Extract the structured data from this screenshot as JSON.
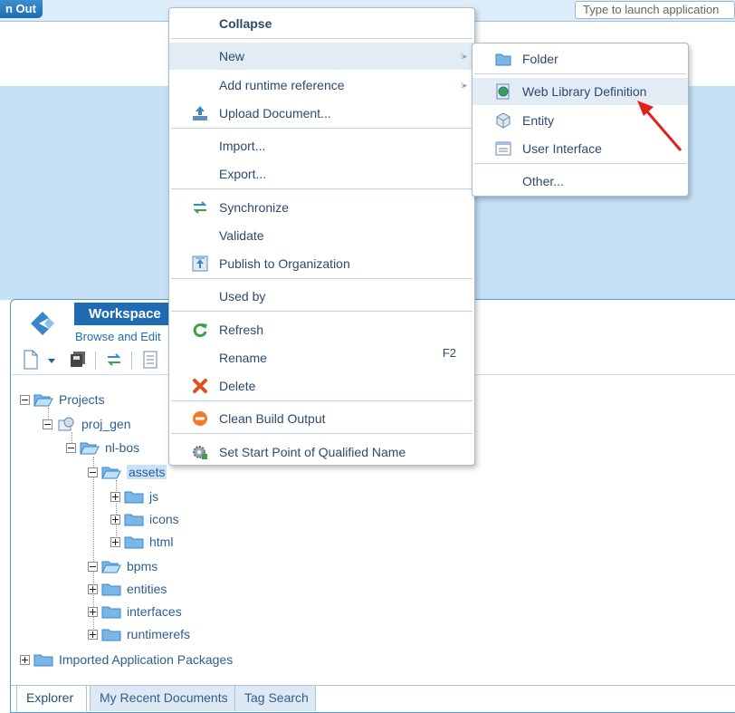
{
  "topbar": {
    "signout_label": "n Out",
    "launch_placeholder": "Type to launch application"
  },
  "workspace": {
    "title": "Workspace",
    "subtitle": "Browse and Edit"
  },
  "tree": {
    "projects": "Projects",
    "proj_gen": "proj_gen",
    "nl_bos": "nl-bos",
    "assets": "assets",
    "js": "js",
    "icons": "icons",
    "html": "html",
    "bpms": "bpms",
    "entities": "entities",
    "interfaces": "interfaces",
    "runtimerefs": "runtimerefs",
    "imported": "Imported Application Packages"
  },
  "tabs": {
    "explorer": "Explorer",
    "recent": "My Recent Documents",
    "tag_search": "Tag Search"
  },
  "context_menu": {
    "collapse": "Collapse",
    "new": "New",
    "add_runtime_reference": "Add runtime reference",
    "upload_document": "Upload Document...",
    "import": "Import...",
    "export": "Export...",
    "synchronize": "Synchronize",
    "validate": "Validate",
    "publish": "Publish to Organization",
    "used_by": "Used by",
    "refresh": "Refresh",
    "rename": "Rename",
    "rename_shortcut": "F2",
    "delete": "Delete",
    "clean_build_output": "Clean Build Output",
    "set_start_point": "Set Start Point of Qualified Name"
  },
  "submenu": {
    "folder": "Folder",
    "web_library_definition": "Web Library Definition",
    "entity": "Entity",
    "user_interface": "User Interface",
    "other": "Other..."
  },
  "colors": {
    "accent": "#1f6cb3",
    "highlight": "#e3ebf4",
    "annotation_arrow": "#e0201c"
  }
}
